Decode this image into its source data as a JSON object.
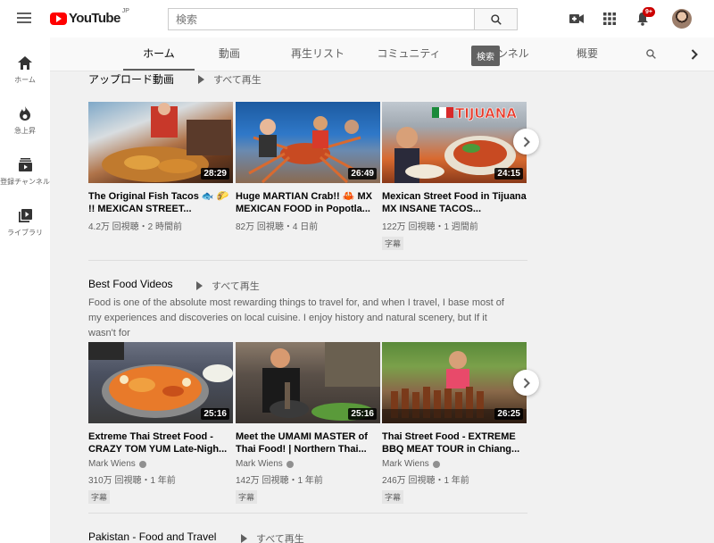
{
  "app": {
    "logo_text": "YouTube",
    "logo_region": "JP"
  },
  "search": {
    "placeholder": "検索",
    "tooltip": "検索"
  },
  "topbar": {
    "notification_count": "9+"
  },
  "leftnav": {
    "items": [
      {
        "label": "ホーム",
        "icon": "home-icon"
      },
      {
        "label": "急上昇",
        "icon": "fire-icon"
      },
      {
        "label": "登録チャンネル",
        "icon": "subscriptions-icon"
      },
      {
        "label": "ライブラリ",
        "icon": "library-icon"
      }
    ]
  },
  "tabs": [
    {
      "label": "ホーム",
      "active": true
    },
    {
      "label": "動画"
    },
    {
      "label": "再生リスト"
    },
    {
      "label": "コミュニティ"
    },
    {
      "label": "チャンネル"
    },
    {
      "label": "概要"
    }
  ],
  "sections": [
    {
      "title": "アップロード動画",
      "play_all": "すべて再生",
      "videos": [
        {
          "title": "The Original Fish Tacos 🐟 🌮 !! MEXICAN STREET...",
          "meta": "4.2万 回視聴・2 時間前",
          "duration": "28:29"
        },
        {
          "title": "Huge MARTIAN Crab!! 🦀 MX MEXICAN FOOD in Popotla...",
          "meta": "82万 回視聴・4 日前",
          "duration": "26:49"
        },
        {
          "title": "Mexican Street Food in Tijuana MX INSANE TACOS...",
          "meta": "122万 回視聴・1 週間前",
          "duration": "24:15",
          "badge": "字幕"
        }
      ]
    },
    {
      "title": "Best Food Videos",
      "play_all": "すべて再生",
      "description": "Food is one of the absolute most rewarding things to travel for, and when I travel, I base most of my experiences and discoveries on local cuisine. I enjoy history and natural scenery, but If it wasn't for",
      "videos": [
        {
          "title": "Extreme Thai Street Food - CRAZY TOM YUM Late-Nigh...",
          "channel": "Mark Wiens",
          "meta": "310万 回視聴・1 年前",
          "duration": "25:16",
          "badge": "字幕"
        },
        {
          "title": "Meet the UMAMI MASTER of Thai Food! | Northern Thai...",
          "channel": "Mark Wiens",
          "meta": "142万 回視聴・1 年前",
          "duration": "25:16",
          "badge": "字幕"
        },
        {
          "title": "Thai Street Food - EXTREME BBQ MEAT TOUR in Chiang...",
          "channel": "Mark Wiens",
          "meta": "246万 回視聴・1 年前",
          "duration": "26:25",
          "badge": "字幕"
        }
      ]
    },
    {
      "title": "Pakistan - Food and Travel",
      "play_all": "すべて再生"
    }
  ],
  "colors": {
    "brand_red": "#ff0000",
    "text_secondary": "#606060",
    "background": "#f1f1f1"
  }
}
